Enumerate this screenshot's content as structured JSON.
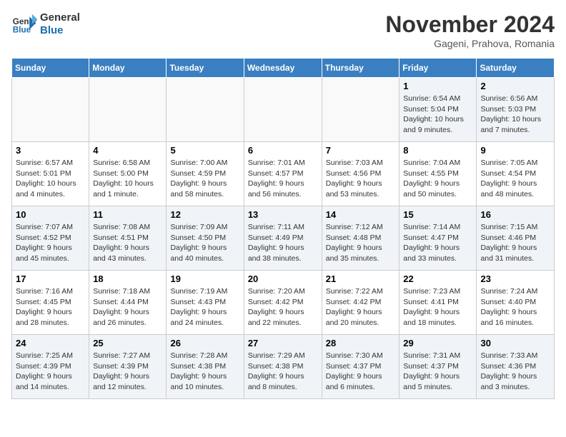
{
  "logo": {
    "line1": "General",
    "line2": "Blue"
  },
  "title": "November 2024",
  "subtitle": "Gageni, Prahova, Romania",
  "weekdays": [
    "Sunday",
    "Monday",
    "Tuesday",
    "Wednesday",
    "Thursday",
    "Friday",
    "Saturday"
  ],
  "weeks": [
    [
      {
        "day": "",
        "info": ""
      },
      {
        "day": "",
        "info": ""
      },
      {
        "day": "",
        "info": ""
      },
      {
        "day": "",
        "info": ""
      },
      {
        "day": "",
        "info": ""
      },
      {
        "day": "1",
        "info": "Sunrise: 6:54 AM\nSunset: 5:04 PM\nDaylight: 10 hours and 9 minutes."
      },
      {
        "day": "2",
        "info": "Sunrise: 6:56 AM\nSunset: 5:03 PM\nDaylight: 10 hours and 7 minutes."
      }
    ],
    [
      {
        "day": "3",
        "info": "Sunrise: 6:57 AM\nSunset: 5:01 PM\nDaylight: 10 hours and 4 minutes."
      },
      {
        "day": "4",
        "info": "Sunrise: 6:58 AM\nSunset: 5:00 PM\nDaylight: 10 hours and 1 minute."
      },
      {
        "day": "5",
        "info": "Sunrise: 7:00 AM\nSunset: 4:59 PM\nDaylight: 9 hours and 58 minutes."
      },
      {
        "day": "6",
        "info": "Sunrise: 7:01 AM\nSunset: 4:57 PM\nDaylight: 9 hours and 56 minutes."
      },
      {
        "day": "7",
        "info": "Sunrise: 7:03 AM\nSunset: 4:56 PM\nDaylight: 9 hours and 53 minutes."
      },
      {
        "day": "8",
        "info": "Sunrise: 7:04 AM\nSunset: 4:55 PM\nDaylight: 9 hours and 50 minutes."
      },
      {
        "day": "9",
        "info": "Sunrise: 7:05 AM\nSunset: 4:54 PM\nDaylight: 9 hours and 48 minutes."
      }
    ],
    [
      {
        "day": "10",
        "info": "Sunrise: 7:07 AM\nSunset: 4:52 PM\nDaylight: 9 hours and 45 minutes."
      },
      {
        "day": "11",
        "info": "Sunrise: 7:08 AM\nSunset: 4:51 PM\nDaylight: 9 hours and 43 minutes."
      },
      {
        "day": "12",
        "info": "Sunrise: 7:09 AM\nSunset: 4:50 PM\nDaylight: 9 hours and 40 minutes."
      },
      {
        "day": "13",
        "info": "Sunrise: 7:11 AM\nSunset: 4:49 PM\nDaylight: 9 hours and 38 minutes."
      },
      {
        "day": "14",
        "info": "Sunrise: 7:12 AM\nSunset: 4:48 PM\nDaylight: 9 hours and 35 minutes."
      },
      {
        "day": "15",
        "info": "Sunrise: 7:14 AM\nSunset: 4:47 PM\nDaylight: 9 hours and 33 minutes."
      },
      {
        "day": "16",
        "info": "Sunrise: 7:15 AM\nSunset: 4:46 PM\nDaylight: 9 hours and 31 minutes."
      }
    ],
    [
      {
        "day": "17",
        "info": "Sunrise: 7:16 AM\nSunset: 4:45 PM\nDaylight: 9 hours and 28 minutes."
      },
      {
        "day": "18",
        "info": "Sunrise: 7:18 AM\nSunset: 4:44 PM\nDaylight: 9 hours and 26 minutes."
      },
      {
        "day": "19",
        "info": "Sunrise: 7:19 AM\nSunset: 4:43 PM\nDaylight: 9 hours and 24 minutes."
      },
      {
        "day": "20",
        "info": "Sunrise: 7:20 AM\nSunset: 4:42 PM\nDaylight: 9 hours and 22 minutes."
      },
      {
        "day": "21",
        "info": "Sunrise: 7:22 AM\nSunset: 4:42 PM\nDaylight: 9 hours and 20 minutes."
      },
      {
        "day": "22",
        "info": "Sunrise: 7:23 AM\nSunset: 4:41 PM\nDaylight: 9 hours and 18 minutes."
      },
      {
        "day": "23",
        "info": "Sunrise: 7:24 AM\nSunset: 4:40 PM\nDaylight: 9 hours and 16 minutes."
      }
    ],
    [
      {
        "day": "24",
        "info": "Sunrise: 7:25 AM\nSunset: 4:39 PM\nDaylight: 9 hours and 14 minutes."
      },
      {
        "day": "25",
        "info": "Sunrise: 7:27 AM\nSunset: 4:39 PM\nDaylight: 9 hours and 12 minutes."
      },
      {
        "day": "26",
        "info": "Sunrise: 7:28 AM\nSunset: 4:38 PM\nDaylight: 9 hours and 10 minutes."
      },
      {
        "day": "27",
        "info": "Sunrise: 7:29 AM\nSunset: 4:38 PM\nDaylight: 9 hours and 8 minutes."
      },
      {
        "day": "28",
        "info": "Sunrise: 7:30 AM\nSunset: 4:37 PM\nDaylight: 9 hours and 6 minutes."
      },
      {
        "day": "29",
        "info": "Sunrise: 7:31 AM\nSunset: 4:37 PM\nDaylight: 9 hours and 5 minutes."
      },
      {
        "day": "30",
        "info": "Sunrise: 7:33 AM\nSunset: 4:36 PM\nDaylight: 9 hours and 3 minutes."
      }
    ]
  ]
}
